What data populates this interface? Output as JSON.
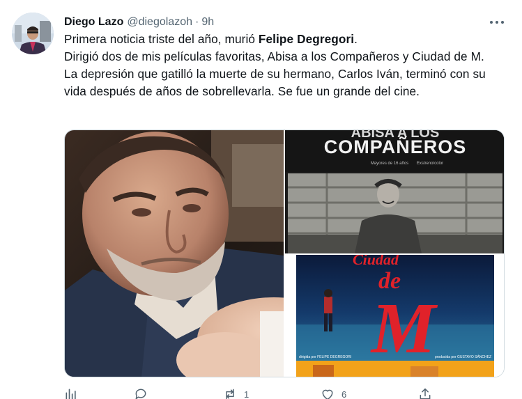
{
  "tweet": {
    "author_name": "Diego Lazo",
    "author_handle": "@diegolazoh",
    "separator": "·",
    "timestamp": "9h",
    "text": {
      "line1_pre": "Primera noticia triste del año, murió ",
      "line1_bold": "Felipe Degregori",
      "line1_post": ".",
      "paragraph2": "Dirigió dos de mis películas favoritas, Abisa a los Compañeros y Ciudad de M.",
      "paragraph3": "La depresión que gatilló la muerte de su hermano, Carlos Iván, terminó con su vida después de años de sobrellevarla. Se fue un grande del cine."
    },
    "media": {
      "poster1_title": "COMPAÑEROS",
      "poster1_top_fragment": "ABISA A LOS",
      "poster1_subtitle_left": "Mayores de 16 años",
      "poster1_subtitle_right": "Exstreno/color",
      "poster2_title_top": "Ciudad",
      "poster2_title_de": "de",
      "poster2_title_m": "M",
      "poster2_credit_left": "dirigida por FELIPE DEGREGORI",
      "poster2_credit_right": "producida por GUSTAVO SÁNCHEZ"
    },
    "actions": {
      "reply_count": "",
      "retweet_count": "1",
      "like_count": "6"
    },
    "icons": {
      "more": "more-horizontal-icon",
      "analytics": "analytics-icon",
      "reply": "reply-icon",
      "retweet": "retweet-icon",
      "like": "like-icon",
      "share": "share-icon"
    },
    "colors": {
      "text": "#0f1419",
      "secondary": "#536471",
      "border": "#cfd9de",
      "poster2_red": "#e0222a"
    }
  }
}
